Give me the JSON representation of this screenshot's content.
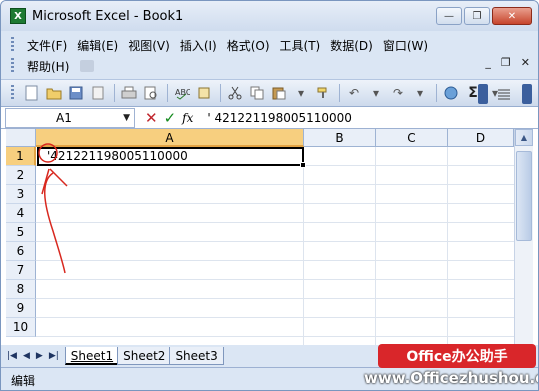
{
  "window": {
    "title": "Microsoft Excel - Book1",
    "app_icon_letter": "X",
    "buttons": {
      "minimize": "—",
      "restore": "❐",
      "close": "✕"
    }
  },
  "menu": {
    "row1": [
      "文件(F)",
      "编辑(E)",
      "视图(V)",
      "插入(I)",
      "格式(O)",
      "工具(T)",
      "数据(D)",
      "窗口(W)"
    ],
    "row2": [
      "帮助(H)"
    ],
    "mdi_buttons": {
      "minimize": "_",
      "restore": "❐",
      "close": "✕"
    }
  },
  "toolbar": {
    "sum_symbol": "Σ",
    "icons": [
      "new-icon",
      "open-icon",
      "save-icon",
      "permission-icon",
      "print-icon",
      "print-preview-icon",
      "spelling-icon",
      "cut-icon",
      "copy-icon",
      "paste-icon",
      "format-painter-icon",
      "undo-icon",
      "redo-icon",
      "hyperlink-icon",
      "autosum-icon",
      "align-icon"
    ]
  },
  "formula_bar": {
    "name_box": "A1",
    "fx_label": "fx",
    "cancel_symbol": "✕",
    "enter_symbol": "✓",
    "content": "' 421221198005110000"
  },
  "grid": {
    "columns": [
      "A",
      "B",
      "C",
      "D"
    ],
    "rows": [
      "1",
      "2",
      "3",
      "4",
      "5",
      "6",
      "7",
      "8",
      "9",
      "10"
    ],
    "cells": {
      "A1": "'421221198005110000"
    },
    "active_cell": "A1"
  },
  "sheets": {
    "nav": [
      "|◀",
      "◀",
      "▶",
      "▶|"
    ],
    "tabs": [
      "Sheet1",
      "Sheet2",
      "Sheet3"
    ],
    "active": "Sheet1"
  },
  "status": {
    "text": "编辑"
  },
  "watermark": {
    "badge": "Office办公助手",
    "site": "www.Officezhushou.com"
  },
  "annotation": {
    "color": "#d8281f"
  }
}
